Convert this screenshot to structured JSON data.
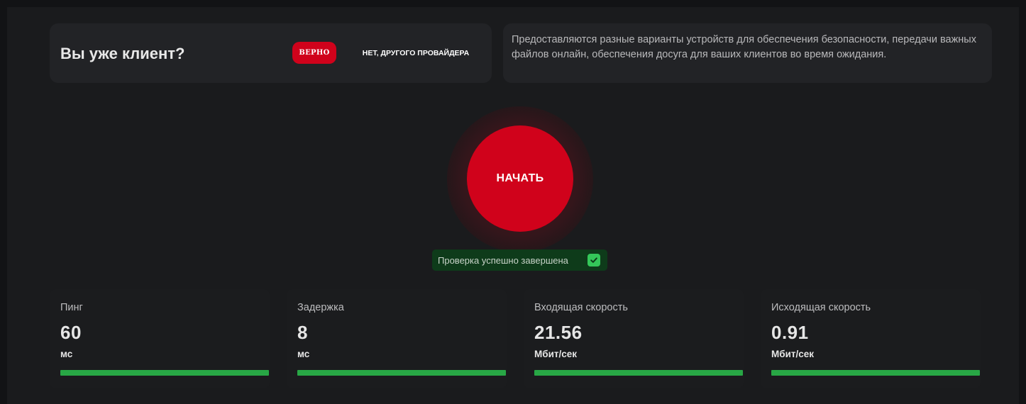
{
  "client_card": {
    "title": "Вы уже клиент?",
    "yes_label": "ВЕРНО",
    "no_label": "НЕТ, ДРУГОГО ПРОВАЙДЕРА"
  },
  "info_card": {
    "text": "Предоставляются разные варианты устройств для обеспечения безопасности, передачи важных файлов онлайн, обеспечения досуга для ваших клиентов во время ожидания."
  },
  "start_button": {
    "label": "НАЧАТЬ"
  },
  "status": {
    "text": "Проверка успешно завершена",
    "icon": "check-icon"
  },
  "metrics": [
    {
      "label": "Пинг",
      "value": "60",
      "unit": "мс",
      "progress": 1.0
    },
    {
      "label": "Задержка",
      "value": "8",
      "unit": "мс",
      "progress": 1.0
    },
    {
      "label": "Входящая скорость",
      "value": "21.56",
      "unit": "Мбит/сек",
      "progress": 1.0
    },
    {
      "label": "Исходящая скорость",
      "value": "0.91",
      "unit": "Мбит/сек",
      "progress": 1.0
    }
  ],
  "colors": {
    "accent_red": "#d0021b",
    "success_green": "#28a745",
    "badge_green_bg": "#0e3b1a",
    "check_green": "#34c759",
    "background": "#1a1b1d",
    "card_bg": "#222326"
  }
}
